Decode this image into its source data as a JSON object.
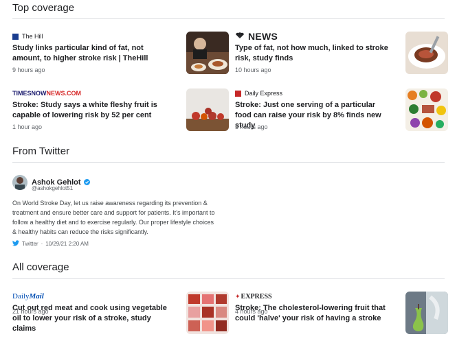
{
  "sections": {
    "top_coverage": "Top coverage",
    "from_twitter": "From Twitter",
    "all_coverage": "All coverage"
  },
  "top": [
    {
      "source": "The Hill",
      "headline": "Study links particular kind of fat, not amount, to higher stroke risk | TheHill",
      "time": "9 hours ago",
      "thumb_icon": "dinner-table-photo"
    },
    {
      "source": "NEWS",
      "headline": "Type of fat, not how much, linked to stroke risk, study finds",
      "time": "10 hours ago",
      "thumb_icon": "steak-photo"
    },
    {
      "source": "TIMESNOWNEWS.COM",
      "source_a": "TIMESNOW",
      "source_b": "NEWS.COM",
      "headline": "Stroke: Study says a white fleshy fruit is capable of lowering risk by 52 per cent",
      "time": "1 hour ago",
      "thumb_icon": "apples-photo"
    },
    {
      "source": "Daily Express",
      "headline": "Stroke: Just one serving of a particular food can raise your risk by 8% finds new study",
      "time": "3 hours ago",
      "thumb_icon": "food-spread-photo"
    }
  ],
  "tweet": {
    "name": "Ashok Gehlot",
    "handle": "@ashokgehlot51",
    "body": "On World Stroke Day, let us raise awareness regarding its prevention & treatment and ensure better care and support for patients. It’s important to follow a healthy diet and to exercise regularly. Our proper lifestyle choices & healthy habits can reduce the risks significantly.",
    "platform": "Twitter",
    "date": "10/29/21 2:20 AM"
  },
  "all": [
    {
      "source": "DailyMail",
      "source_a": "Daily",
      "source_b": "Mail",
      "headline": "Cut out red meat and cook using vegetable oil to lower your risk of a stroke, study claims",
      "time": "21 hours ago",
      "thumb_icon": "red-meat-photo"
    },
    {
      "source": "EXPRESS",
      "headline": "Stroke: The cholesterol-lowering fruit that could 'halve' your risk of having a stroke",
      "time": "4 hours ago",
      "thumb_icon": "pear-photo"
    }
  ],
  "colors": {
    "accent": "#1a73e8",
    "timesnow_red": "#d62828",
    "dailymail_blue": "#004db3",
    "text": "#202124",
    "muted": "#5f6368"
  }
}
